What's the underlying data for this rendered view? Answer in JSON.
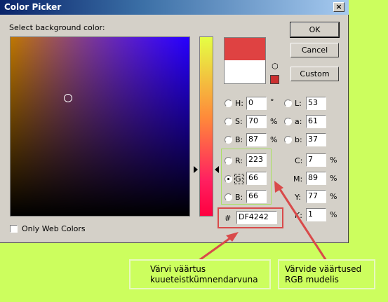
{
  "dialog": {
    "title": "Color Picker",
    "close_glyph": "×",
    "select_label": "Select background color:",
    "ok_label": "OK",
    "cancel_label": "Cancel",
    "custom_label": "Custom",
    "only_web_colors_label": "Only Web Colors",
    "only_web_colors_checked": false,
    "current_color": "#df4242",
    "previous_color": "#ffffff"
  },
  "hsb": {
    "h": {
      "label": "H:",
      "value": "0",
      "unit": "°"
    },
    "s": {
      "label": "S:",
      "value": "70",
      "unit": "%"
    },
    "b": {
      "label": "B:",
      "value": "87",
      "unit": "%"
    }
  },
  "lab": {
    "l": {
      "label": "L:",
      "value": "53"
    },
    "a": {
      "label": "a:",
      "value": "61"
    },
    "b": {
      "label": "b:",
      "value": "37"
    }
  },
  "rgb": {
    "r": {
      "label": "R:",
      "value": "223"
    },
    "g": {
      "label": "G:",
      "value": "66",
      "selected": true
    },
    "b": {
      "label": "B:",
      "value": "66"
    }
  },
  "cmyk": {
    "c": {
      "label": "C:",
      "value": "7",
      "unit": "%"
    },
    "m": {
      "label": "M:",
      "value": "89",
      "unit": "%"
    },
    "y": {
      "label": "Y:",
      "value": "77",
      "unit": "%"
    },
    "k": {
      "label": "K:",
      "value": "1",
      "unit": "%"
    }
  },
  "hex": {
    "label": "#",
    "value": "DF4242"
  },
  "annotations": {
    "hex_note_line1": "Värvi väärtus",
    "hex_note_line2": "kuueteistkümnendarvuna",
    "rgb_note_line1": "Värvide väärtused",
    "rgb_note_line2": "RGB mudelis"
  },
  "colors": {
    "annotation_arrow": "#d94a4a",
    "background": "#ccfe5e"
  }
}
